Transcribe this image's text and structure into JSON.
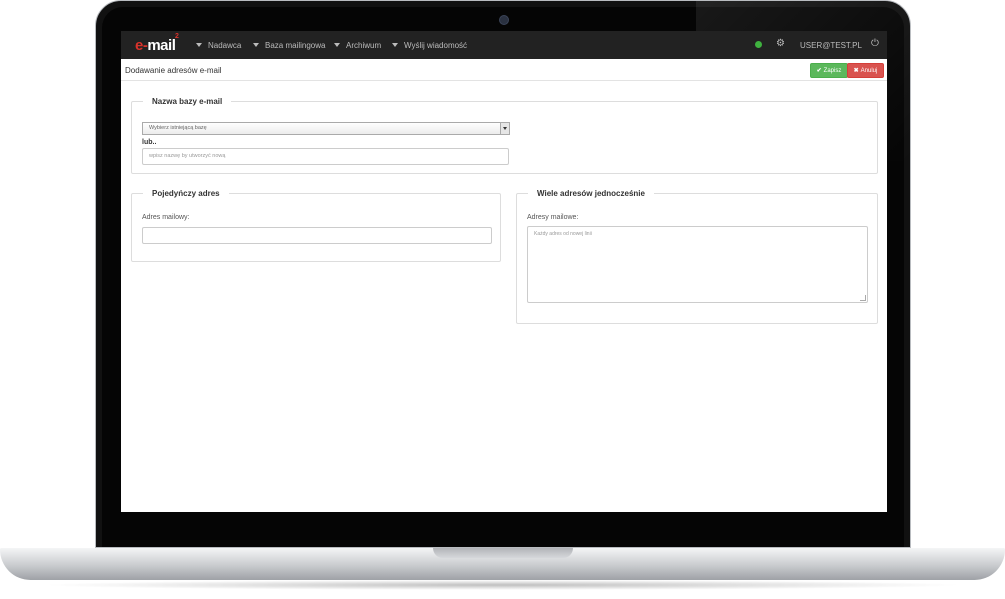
{
  "nav": {
    "logo_text": "mail",
    "logo_prefix": "e-",
    "logo_sup": "2",
    "items": [
      {
        "label": "Nadawca"
      },
      {
        "label": "Baza mailingowa"
      },
      {
        "label": "Archiwum"
      },
      {
        "label": "Wyślij wiadomość"
      }
    ],
    "user_email": "USER@TEST.PL",
    "status_color": "#3fb23f",
    "icons": [
      "check-circle-icon",
      "gears-icon",
      "power-icon"
    ]
  },
  "subheader": {
    "title": "Dodawanie adresów e-mail",
    "save_label": "Zapisz",
    "cancel_label": "Anuluj"
  },
  "base_section": {
    "legend": "Nazwa bazy e-mail",
    "select_value": "Wybierz istniejącą bazę",
    "or_label": "lub..",
    "new_name_placeholder": "wpisz nazwę by utworzyć nową"
  },
  "single_section": {
    "legend": "Pojedyńczy adres",
    "label": "Adres mailowy:",
    "value": ""
  },
  "multi_section": {
    "legend": "Wiele adresów jednocześnie",
    "label": "Adresy mailowe:",
    "placeholder": "Każdy adres od nowej linii"
  },
  "colors": {
    "navbar": "#222222",
    "save": "#5cb85c",
    "cancel": "#d9534f",
    "logo_accent": "#d9322b"
  }
}
